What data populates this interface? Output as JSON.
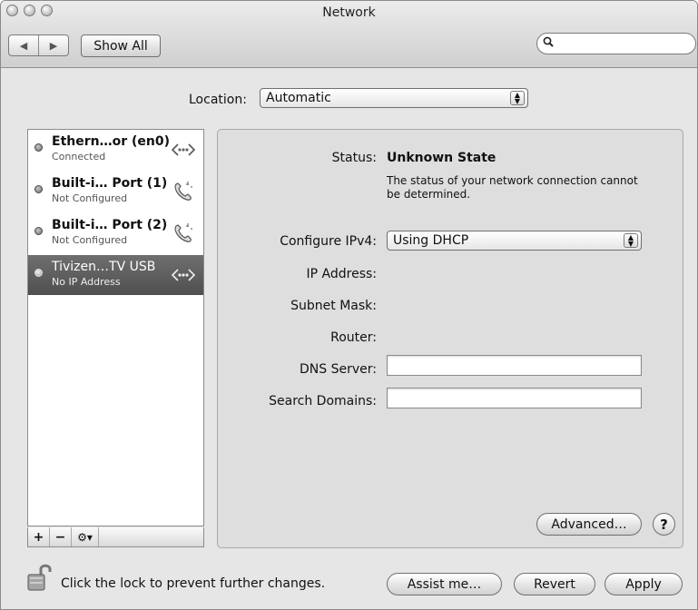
{
  "window": {
    "title": "Network"
  },
  "toolbar": {
    "back_icon": "back-arrow-icon",
    "forward_icon": "forward-arrow-icon",
    "show_all_label": "Show All",
    "search_placeholder": ""
  },
  "location": {
    "label": "Location:",
    "value": "Automatic"
  },
  "services": [
    {
      "name": "Ethern…or (en0)",
      "status": "Connected",
      "icon": "ethernet-icon",
      "selected": false
    },
    {
      "name": "Built-i… Port (1)",
      "status": "Not Configured",
      "icon": "phone-modem-icon",
      "selected": false
    },
    {
      "name": "Built-i… Port (2)",
      "status": "Not Configured",
      "icon": "phone-modem-icon",
      "selected": false
    },
    {
      "name": "Tivizen…TV USB",
      "status": "No IP Address",
      "icon": "ethernet-icon",
      "selected": true
    }
  ],
  "service_tools": {
    "add": "+",
    "remove": "−",
    "gear": "⚙▾"
  },
  "detail": {
    "status_label": "Status:",
    "status_value": "Unknown State",
    "status_desc": "The status of your network connection cannot be determined.",
    "configure_label": "Configure IPv4:",
    "configure_value": "Using DHCP",
    "ip_label": "IP Address:",
    "subnet_label": "Subnet Mask:",
    "router_label": "Router:",
    "dns_label": "DNS Server:",
    "dns_value": "",
    "search_label": "Search Domains:",
    "search_value": "",
    "advanced_label": "Advanced…",
    "help_label": "?"
  },
  "footer": {
    "lock_text": "Click the lock to prevent further changes.",
    "assist_label": "Assist me…",
    "revert_label": "Revert",
    "apply_label": "Apply"
  }
}
